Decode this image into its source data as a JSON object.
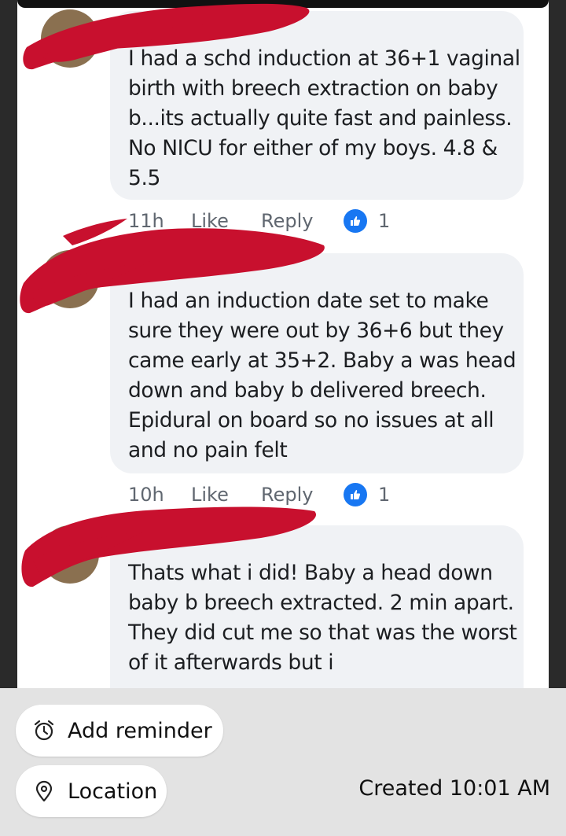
{
  "comments": [
    {
      "text": "I had a schd induction at 36+1 vaginal birth with breech extraction on baby b...its actually quite fast and painless. No NICU for either of my boys. 4.8 & 5.5",
      "time": "11h",
      "like_label": "Like",
      "reply_label": "Reply",
      "reactions": "1"
    },
    {
      "text": "I had an induction date set to make sure they were out by 36+6 but they came early at 35+2.  Baby a was head down and baby b delivered breech. Epidural on board so no issues at all and no pain felt",
      "time": "10h",
      "like_label": "Like",
      "reply_label": "Reply",
      "reactions": "1"
    },
    {
      "text": "Thats what i did! Baby a head down baby b breech extracted. 2 min apart. They did cut me so that was the worst of it afterwards but i"
    }
  ],
  "reaction_color": "#1877f2",
  "redaction_color": "#c8102e",
  "bottom_panel": {
    "add_reminder": {
      "label": "Add reminder",
      "icon": "alarm-clock-icon"
    },
    "location": {
      "label": "Location",
      "icon": "location-pin-icon"
    },
    "created": "Created 10:01 AM"
  }
}
